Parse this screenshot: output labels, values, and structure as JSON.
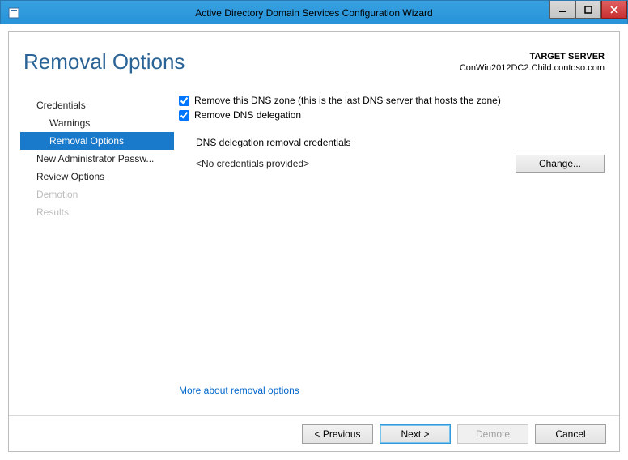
{
  "window": {
    "title": "Active Directory Domain Services Configuration Wizard"
  },
  "heading": "Removal Options",
  "target": {
    "label": "TARGET SERVER",
    "server": "ConWin2012DC2.Child.contoso.com"
  },
  "nav": {
    "items": [
      {
        "label": "Credentials",
        "kind": "top"
      },
      {
        "label": "Warnings",
        "kind": "sub"
      },
      {
        "label": "Removal Options",
        "kind": "sub",
        "selected": true
      },
      {
        "label": "New Administrator Passw...",
        "kind": "top"
      },
      {
        "label": "Review Options",
        "kind": "top"
      },
      {
        "label": "Demotion",
        "kind": "top",
        "disabled": true
      },
      {
        "label": "Results",
        "kind": "top",
        "disabled": true
      }
    ]
  },
  "options": {
    "remove_zone": {
      "label": "Remove this DNS zone (this is the last DNS server that hosts the zone)",
      "checked": true
    },
    "remove_deleg": {
      "label": "Remove DNS delegation",
      "checked": true
    },
    "delegation_heading": "DNS delegation removal credentials",
    "credentials_text": "<No credentials provided>",
    "change_label": "Change...",
    "more_link": "More about removal options"
  },
  "footer": {
    "previous": "< Previous",
    "next": "Next >",
    "demote": "Demote",
    "cancel": "Cancel"
  }
}
